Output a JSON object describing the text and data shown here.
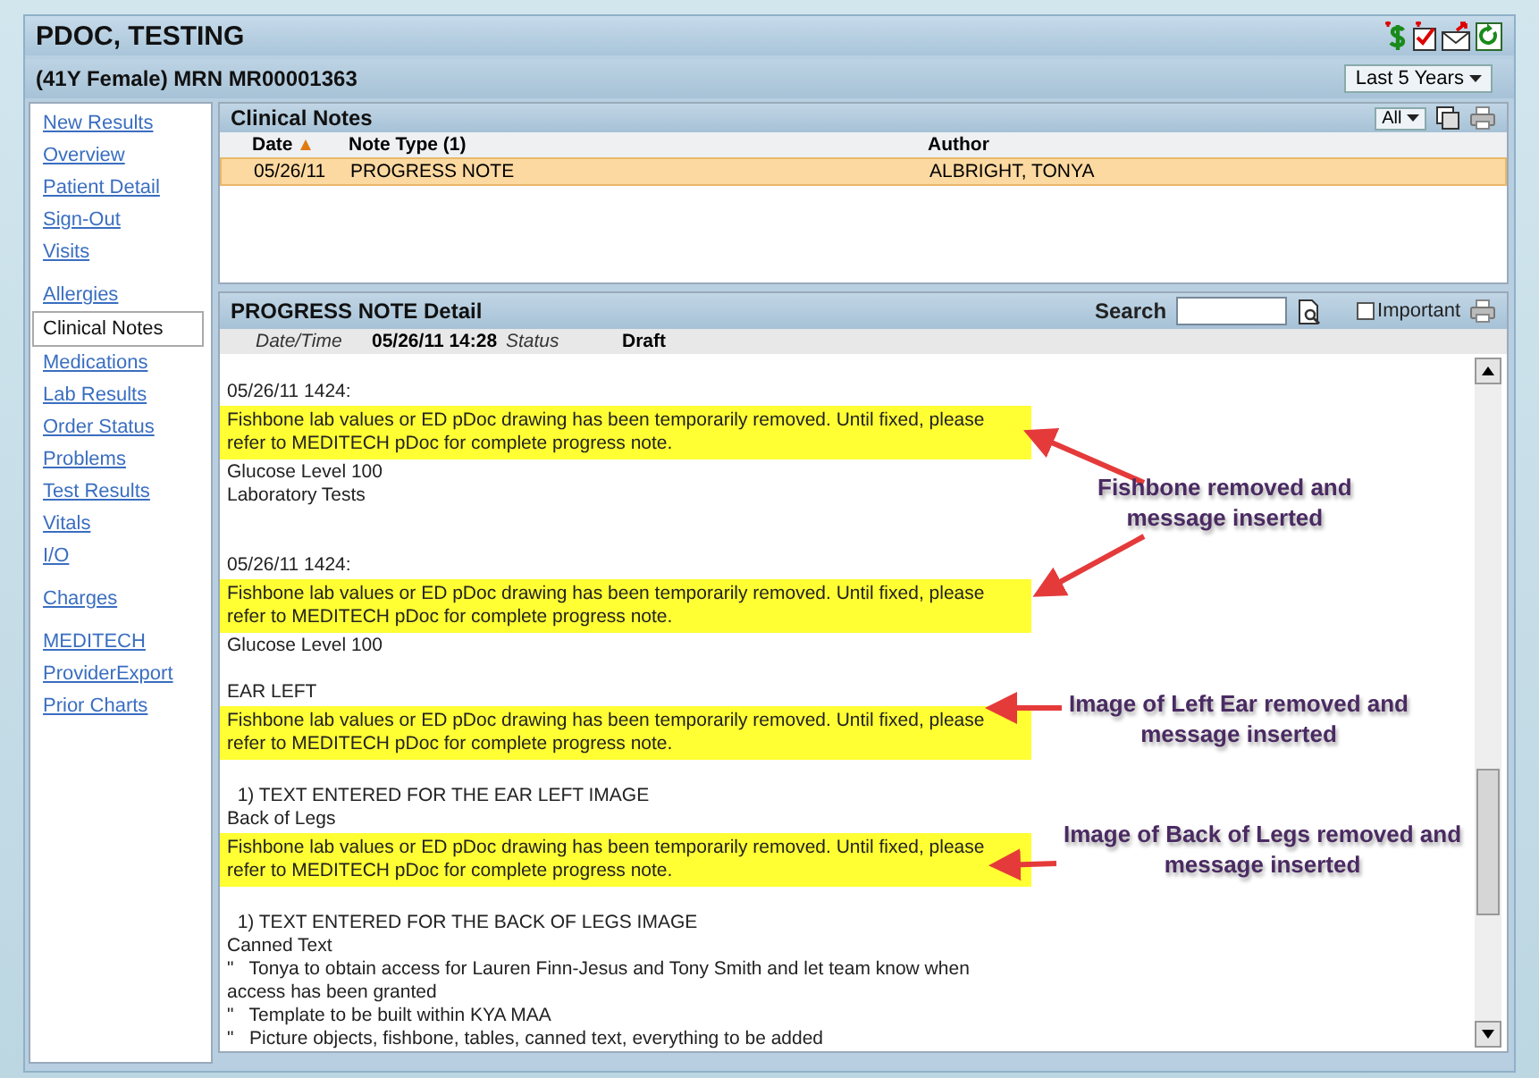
{
  "window": {
    "title": "PDOC, TESTING"
  },
  "patient": {
    "label": "(41Y Female) MRN MR00001363",
    "range_button": "Last 5 Years"
  },
  "sidebar": {
    "groups": [
      [
        {
          "label": "New Results",
          "selected": false
        },
        {
          "label": "Overview",
          "selected": false
        },
        {
          "label": "Patient Detail",
          "selected": false
        },
        {
          "label": "Sign-Out",
          "selected": false
        },
        {
          "label": "Visits",
          "selected": false
        }
      ],
      [
        {
          "label": "Allergies",
          "selected": false
        },
        {
          "label": "Clinical Notes",
          "selected": true
        },
        {
          "label": "Medications",
          "selected": false
        },
        {
          "label": "Lab Results",
          "selected": false
        },
        {
          "label": "Order Status",
          "selected": false
        },
        {
          "label": "Problems",
          "selected": false
        },
        {
          "label": "Test Results",
          "selected": false
        },
        {
          "label": "Vitals",
          "selected": false
        },
        {
          "label": "I/O",
          "selected": false
        }
      ],
      [
        {
          "label": "Charges",
          "selected": false
        }
      ],
      [
        {
          "label": "MEDITECH",
          "selected": false
        },
        {
          "label": "ProviderExport",
          "selected": false
        },
        {
          "label": "Prior Charts",
          "selected": false
        }
      ]
    ]
  },
  "clinical_notes": {
    "title": "Clinical Notes",
    "filter": "All",
    "columns": [
      {
        "label": "Date",
        "sorted": true
      },
      {
        "label": "Note Type (1)",
        "sorted": false
      },
      {
        "label": "Author",
        "sorted": false
      }
    ],
    "rows": [
      {
        "cells": [
          "05/26/11",
          "PROGRESS NOTE",
          "ALBRIGHT, TONYA"
        ],
        "selected": true
      }
    ]
  },
  "detail": {
    "title": "PROGRESS NOTE Detail",
    "search_label": "Search",
    "important": {
      "label": "Important",
      "checked": false
    },
    "meta": [
      {
        "label": "Date/Time",
        "value": "05/26/11 14:28"
      },
      {
        "label": "Status",
        "value": "Draft"
      }
    ],
    "body": [
      {
        "kind": "blank"
      },
      {
        "kind": "text",
        "lines": [
          "05/26/11 1424:"
        ]
      },
      {
        "kind": "highlight",
        "lines": [
          "Fishbone lab values or ED pDoc drawing has been temporarily removed. Until fixed, please",
          "refer to MEDITECH pDoc for complete progress note."
        ]
      },
      {
        "kind": "text",
        "lines": [
          "Glucose Level 100"
        ]
      },
      {
        "kind": "text",
        "lines": [
          "Laboratory Tests"
        ]
      },
      {
        "kind": "blank"
      },
      {
        "kind": "blank"
      },
      {
        "kind": "text",
        "lines": [
          "05/26/11 1424:"
        ]
      },
      {
        "kind": "highlight",
        "lines": [
          "Fishbone lab values or ED pDoc drawing has been temporarily removed. Until fixed, please",
          "refer to MEDITECH pDoc for complete progress note."
        ]
      },
      {
        "kind": "text",
        "lines": [
          "Glucose Level 100"
        ]
      },
      {
        "kind": "blank"
      },
      {
        "kind": "text",
        "lines": [
          "EAR LEFT"
        ]
      },
      {
        "kind": "highlight",
        "lines": [
          "Fishbone lab values or ED pDoc drawing has been temporarily removed. Until fixed, please",
          "refer to MEDITECH pDoc for complete progress note."
        ]
      },
      {
        "kind": "blank"
      },
      {
        "kind": "text",
        "lines": [
          "  1) TEXT ENTERED FOR THE EAR LEFT IMAGE"
        ]
      },
      {
        "kind": "text",
        "lines": [
          "Back of Legs"
        ]
      },
      {
        "kind": "highlight",
        "lines": [
          "Fishbone lab values or ED pDoc drawing has been temporarily removed. Until fixed, please",
          "refer to MEDITECH pDoc for complete progress note."
        ]
      },
      {
        "kind": "blank"
      },
      {
        "kind": "text",
        "lines": [
          "  1) TEXT ENTERED FOR THE BACK OF LEGS IMAGE"
        ]
      },
      {
        "kind": "text",
        "lines": [
          "Canned Text"
        ]
      },
      {
        "kind": "text",
        "lines": [
          "\"   Tonya to obtain access for Lauren Finn-Jesus and Tony Smith and let team know when",
          "access has been granted"
        ]
      },
      {
        "kind": "text",
        "lines": [
          "\"   Template to be built within KYA MAA"
        ]
      },
      {
        "kind": "text",
        "lines": [
          "\"   Picture objects, fishbone, tables, canned text, everything to be added"
        ]
      }
    ]
  },
  "annotations": [
    {
      "lines": [
        "Fishbone removed and",
        "message inserted"
      ]
    },
    {
      "lines": [
        "Image of Left Ear removed and",
        "message inserted"
      ]
    },
    {
      "lines": [
        "Image of Back of Legs removed and",
        "message inserted"
      ]
    }
  ]
}
